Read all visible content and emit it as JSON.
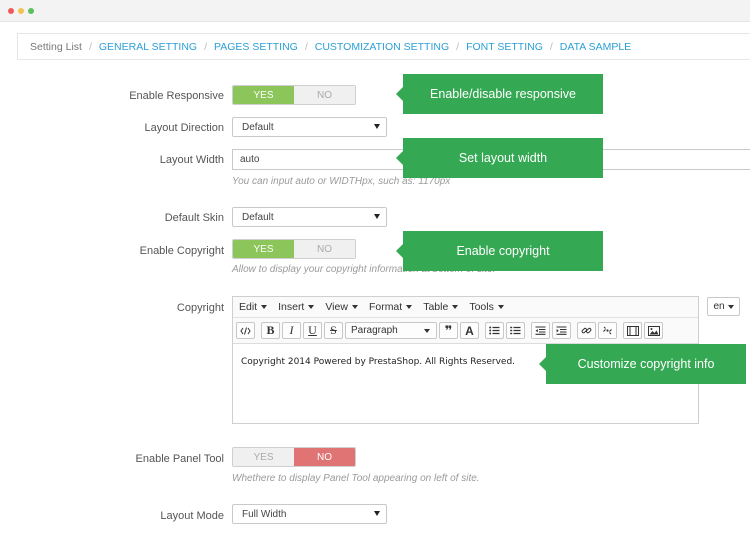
{
  "window": {
    "dots": [
      "close",
      "minimize",
      "maximize"
    ]
  },
  "breadcrumb": {
    "items": [
      "Setting List",
      "GENERAL SETTING",
      "PAGES SETTING",
      "CUSTOMIZATION SETTING",
      "FONT SETTING",
      "DATA SAMPLE"
    ],
    "separator": "/"
  },
  "form": {
    "enable_responsive": {
      "label": "Enable Responsive",
      "yes": "YES",
      "no": "NO",
      "value": "YES"
    },
    "layout_direction": {
      "label": "Layout Direction",
      "value": "Default"
    },
    "layout_width": {
      "label": "Layout Width",
      "value": "auto",
      "help": "You can input auto or WIDTHpx, such as: 1170px"
    },
    "default_skin": {
      "label": "Default Skin",
      "value": "Default"
    },
    "enable_copyright": {
      "label": "Enable Copyright",
      "yes": "YES",
      "no": "NO",
      "value": "YES",
      "help": "Allow to display your copyright information at bottom of site."
    },
    "copyright": {
      "label": "Copyright",
      "menu": [
        "Edit",
        "Insert",
        "View",
        "Format",
        "Table",
        "Tools"
      ],
      "format_value": "Paragraph",
      "content": "Copyright 2014 Powered by PrestaShop. All Rights Reserved.",
      "language": "en"
    },
    "enable_panel_tool": {
      "label": "Enable Panel Tool",
      "yes": "YES",
      "no": "NO",
      "value": "NO",
      "help": "Whethere to display Panel Tool appearing on left of site."
    },
    "layout_mode": {
      "label": "Layout Mode",
      "value": "Full Width"
    }
  },
  "tooltips": {
    "responsive": "Enable/disable responsive",
    "width": "Set layout width",
    "copyright": "Enable copyright",
    "copyright_info": "Customize copyright info"
  },
  "colors": {
    "accent": "#2b9fd6",
    "yes": "#8cc559",
    "no_active": "#e07474",
    "tooltip": "#34a853"
  }
}
